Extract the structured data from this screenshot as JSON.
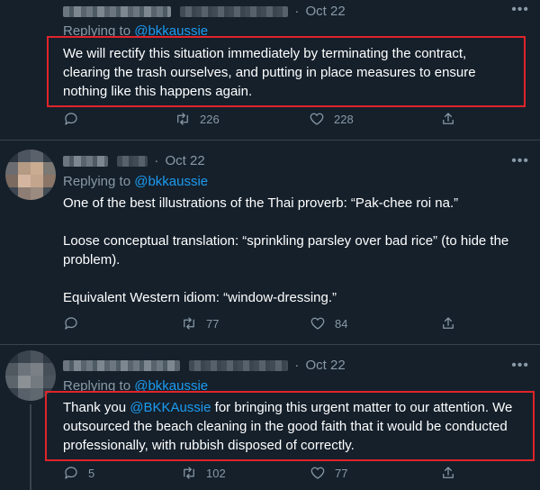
{
  "tweets": [
    {
      "date": "Oct 22",
      "replying_label": "Replying to",
      "replying_handle": "@bkkaussie",
      "paragraphs": [
        "We will rectify this situation immediately by terminating the contract, clearing the trash ourselves, and putting in place measures to ensure nothing like this happens again."
      ],
      "replies": "",
      "retweets": "226",
      "likes": "228"
    },
    {
      "date": "Oct 22",
      "replying_label": "Replying to",
      "replying_handle": "@bkkaussie",
      "paragraphs": [
        "One of the best illustrations of the Thai proverb:  “Pak-chee roi na.”",
        "Loose conceptual translation: “sprinkling parsley over bad  rice” (to hide the problem).",
        "Equivalent Western idiom: “window-dressing.”"
      ],
      "replies": "",
      "retweets": "77",
      "likes": "84"
    },
    {
      "date": "Oct 22",
      "replying_label": "Replying to",
      "replying_handle": "@bkkaussie",
      "text_before": "Thank you ",
      "text_mention": "@BKKAussie",
      "text_after": " for bringing this urgent matter to our attention. We outsourced the beach cleaning in the good faith that it would be conducted professionally, with rubbish disposed of correctly.",
      "replies": "5",
      "retweets": "102",
      "likes": "77"
    }
  ],
  "icons": [
    "reply-icon",
    "retweet-icon",
    "like-icon",
    "share-icon",
    "more-icon"
  ],
  "colors": {
    "background": "#15202b",
    "text": "#ffffff",
    "muted": "#8899a6",
    "link": "#1d9bf0",
    "highlight_box": "#e0242a"
  }
}
